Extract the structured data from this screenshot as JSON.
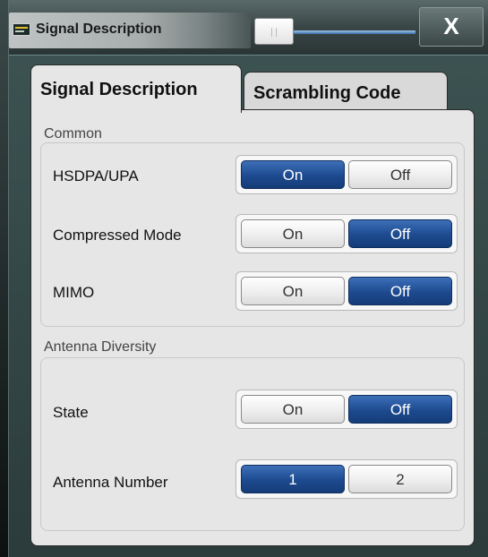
{
  "window": {
    "title": "Signal Description",
    "close_label": "X"
  },
  "tabs": [
    {
      "label": "Signal Description",
      "active": true
    },
    {
      "label": "Scrambling Code",
      "active": false
    }
  ],
  "common": {
    "heading": "Common",
    "rows": [
      {
        "label": "HSDPA/UPA",
        "options": [
          "On",
          "Off"
        ],
        "selected": "On"
      },
      {
        "label": "Compressed Mode",
        "options": [
          "On",
          "Off"
        ],
        "selected": "Off"
      },
      {
        "label": "MIMO",
        "options": [
          "On",
          "Off"
        ],
        "selected": "Off"
      }
    ]
  },
  "antenna_diversity": {
    "heading": "Antenna Diversity",
    "rows": [
      {
        "label": "State",
        "options": [
          "On",
          "Off"
        ],
        "selected": "Off"
      },
      {
        "label": "Antenna Number",
        "options": [
          "1",
          "2"
        ],
        "selected": "1"
      }
    ]
  },
  "colors": {
    "selected_option": "#1d4a8f",
    "panel_bg": "#e6e6e6",
    "window_bg": "#2c3b3b"
  }
}
